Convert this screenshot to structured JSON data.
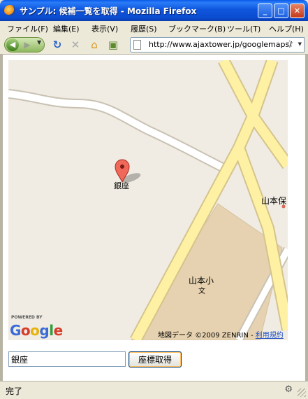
{
  "window": {
    "title": "サンプル: 候補一覧を取得 - Mozilla Firefox",
    "buttons": {
      "minimize": "_",
      "maximize": "□",
      "close": "✕"
    }
  },
  "menu": [
    "ファイル(F)",
    "編集(E)",
    "表示(V)",
    "履歴(S)",
    "ブックマーク(B)",
    "ツール(T)",
    "ヘルプ(H)"
  ],
  "toolbar": {
    "back_icon": "back-arrow-icon",
    "forward_icon": "forward-arrow-icon",
    "url": "http://www.ajaxtower.jp/googlemaps/"
  },
  "map": {
    "marker_label": "銀座",
    "labels": {
      "yamamotoho": "山本保",
      "school": "山本小",
      "school_symbol": "文"
    },
    "powered_by": "POWERED BY",
    "logo": "Google",
    "copyright": "地図データ ©2009 ZENRIN - ",
    "terms": "利用規約",
    "colors": {
      "background": "#f0ece3",
      "major_road": "#fff1a4",
      "minor_road": "#ffffff",
      "area": "#e6d2b0"
    }
  },
  "form": {
    "input_value": "銀座",
    "button_label": "座標取得"
  },
  "status": {
    "text": "完了"
  }
}
